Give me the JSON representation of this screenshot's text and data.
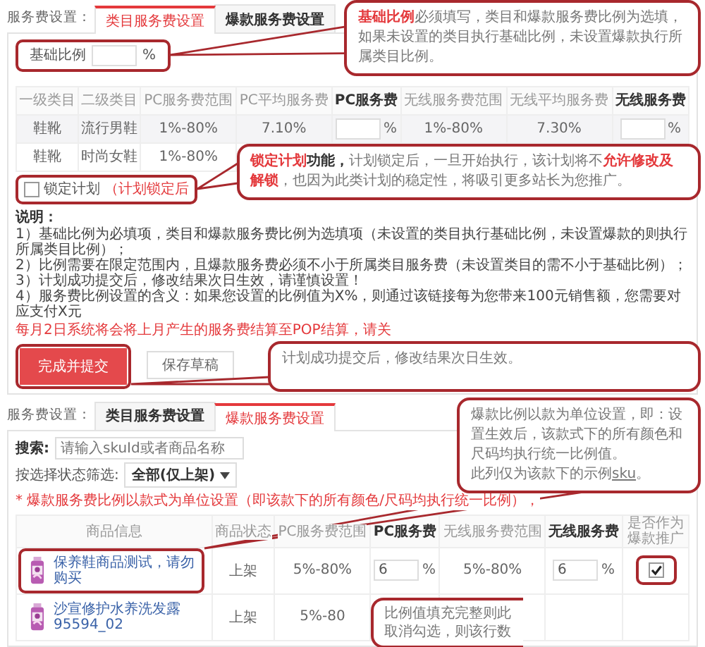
{
  "category_panel": {
    "label": "服务费设置：",
    "tabs": [
      {
        "label": "类目服务费设置",
        "selected": true
      },
      {
        "label": "爆款服务费设置",
        "selected": false
      }
    ],
    "base_ratio": {
      "label": "基础比例",
      "unit": "%",
      "highlighted": true,
      "callout": {
        "paragraphs": [
          [
            {
              "text": "基础比例",
              "kind": "accent"
            },
            {
              "text": "必须填写，类目和爆款服务费比例为选填，如果未设置的类目执行基础比例，未设置爆款执行所属类目比例。"
            }
          ]
        ]
      }
    },
    "table": {
      "columns": [
        {
          "label": "一级类目",
          "bold": false
        },
        {
          "label": "二级类目",
          "bold": false
        },
        {
          "label": "PC服务费范围",
          "bold": false
        },
        {
          "label": "PC平均服务费",
          "bold": false
        },
        {
          "label": "PC服务费",
          "bold": true
        },
        {
          "label": "无线服务费范围",
          "bold": false
        },
        {
          "label": "无线平均服务费",
          "bold": false
        },
        {
          "label": "无线服务费",
          "bold": true
        }
      ],
      "rows": [
        {
          "cells": [
            {
              "kind": "text",
              "text": "鞋靴"
            },
            {
              "kind": "text",
              "text": "流行男鞋"
            },
            {
              "kind": "text",
              "text": "1%-80%"
            },
            {
              "kind": "text",
              "text": "7.10%"
            },
            {
              "kind": "input",
              "unit": "%"
            },
            {
              "kind": "text",
              "text": "1%-80%"
            },
            {
              "kind": "text",
              "text": "7.30%"
            },
            {
              "kind": "input",
              "unit": "%"
            }
          ]
        },
        {
          "cells": [
            {
              "kind": "text",
              "text": "鞋靴"
            },
            {
              "kind": "text",
              "text": "时尚女鞋"
            },
            {
              "kind": "text",
              "text": "1%-80%"
            }
          ]
        }
      ]
    },
    "lock": {
      "label": "锁定计划",
      "hint": "（计划锁定后",
      "checked": false,
      "highlighted": true,
      "callout": {
        "paragraphs": [
          [
            {
              "text": "锁定计划",
              "kind": "accent"
            },
            {
              "text": "功能，",
              "kind": "strong"
            },
            {
              "text": "计划锁定后，一旦开始执行，该计划将不"
            },
            {
              "text": "允许修改及解锁",
              "kind": "accent"
            },
            {
              "text": "，也因为此类计划的稳定性，将吸引更多站长为您推广。"
            }
          ]
        ]
      }
    },
    "notes": {
      "title": "说明：",
      "items": [
        "1）基础比例为必填项，类目和爆款服务费比例为选填项（未设置的类目执行基础比例，未设置爆款的则执行所属类目比例）；",
        "2）比例需要在限定范围内，且爆款服务费必须不小于所属类目服务费（未设置类目的需不小于基础比例）；",
        "3）计划成功提交后，修改结果次日生效，请谨慎设置！",
        "4）服务费比例设置的含义：如果您设置的比例值为X%，则通过该链接每为您带来100元销售额，您需要对应支付X元"
      ],
      "warning": "每月2日系统将会将上月产生的服务费结算至POP结算，请关"
    },
    "buttons": [
      {
        "label": "完成并提交",
        "kind": "primary",
        "highlighted": true,
        "callout": {
          "paragraphs": [
            [
              {
                "text": "计划成功提交后，修改结果次日生效。"
              }
            ]
          ]
        }
      },
      {
        "label": "保存草稿",
        "kind": "default",
        "highlighted": false
      }
    ]
  },
  "hot_panel": {
    "label": "服务费设置：",
    "tabs": [
      {
        "label": "类目服务费设置",
        "selected": false
      },
      {
        "label": "爆款服务费设置",
        "selected": true
      }
    ],
    "search": {
      "label": "搜索:",
      "placeholder": "请输入skuId或者商品名称"
    },
    "filter": {
      "label": "按选择状态筛选:",
      "value": "全部(仅上架)"
    },
    "note": "* 爆款服务费比例以款式为单位设置（即该款下的所有颜色/尺码均执行统一比例），",
    "table": {
      "columns": [
        {
          "label": "商品信息",
          "bold": false
        },
        {
          "label": "商品状态",
          "bold": false
        },
        {
          "label": "PC服务费范围",
          "bold": false
        },
        {
          "label": "PC服务费",
          "bold": true
        },
        {
          "label": "无线服务费范围",
          "bold": false
        },
        {
          "label": "无线服务费",
          "bold": true
        },
        {
          "label": "是否作为爆款推广",
          "bold": false
        }
      ],
      "rows": [
        {
          "cells": [
            {
              "kind": "product",
              "text": "保养鞋商品测试，请勿购买",
              "highlighted": true,
              "callout": {
                "paragraphs": [
                  [
                    {
                      "text": "爆款比例以款为单位设置，即：设置生效后，该款式下的所有颜色和尺码均执行统一比例值。"
                    }
                  ],
                  [
                    {
                      "text": "此列仅为该款下的示例"
                    },
                    {
                      "text": "sku",
                      "kind": "underline"
                    },
                    {
                      "text": "。"
                    }
                  ]
                ]
              }
            },
            {
              "kind": "text",
              "text": "上架"
            },
            {
              "kind": "text",
              "text": "5%-80%"
            },
            {
              "kind": "input",
              "value": "6",
              "unit": "%"
            },
            {
              "kind": "text",
              "text": "5%-80%"
            },
            {
              "kind": "input",
              "value": "6",
              "unit": "%"
            },
            {
              "kind": "checkbox",
              "checked": true,
              "highlighted": true
            }
          ]
        },
        {
          "cells": [
            {
              "kind": "product",
              "text": "沙宣修护水养洗发露95594_02",
              "highlighted": false
            },
            {
              "kind": "text",
              "text": "上架"
            },
            {
              "kind": "text",
              "text": "5%-80"
            }
          ]
        }
      ]
    },
    "callouts": [
      {
        "paragraphs": [
          [
            {
              "text": "比例值填充完整则此"
            }
          ],
          [
            {
              "text": "取消勾选，则该行数"
            }
          ]
        ]
      }
    ]
  }
}
